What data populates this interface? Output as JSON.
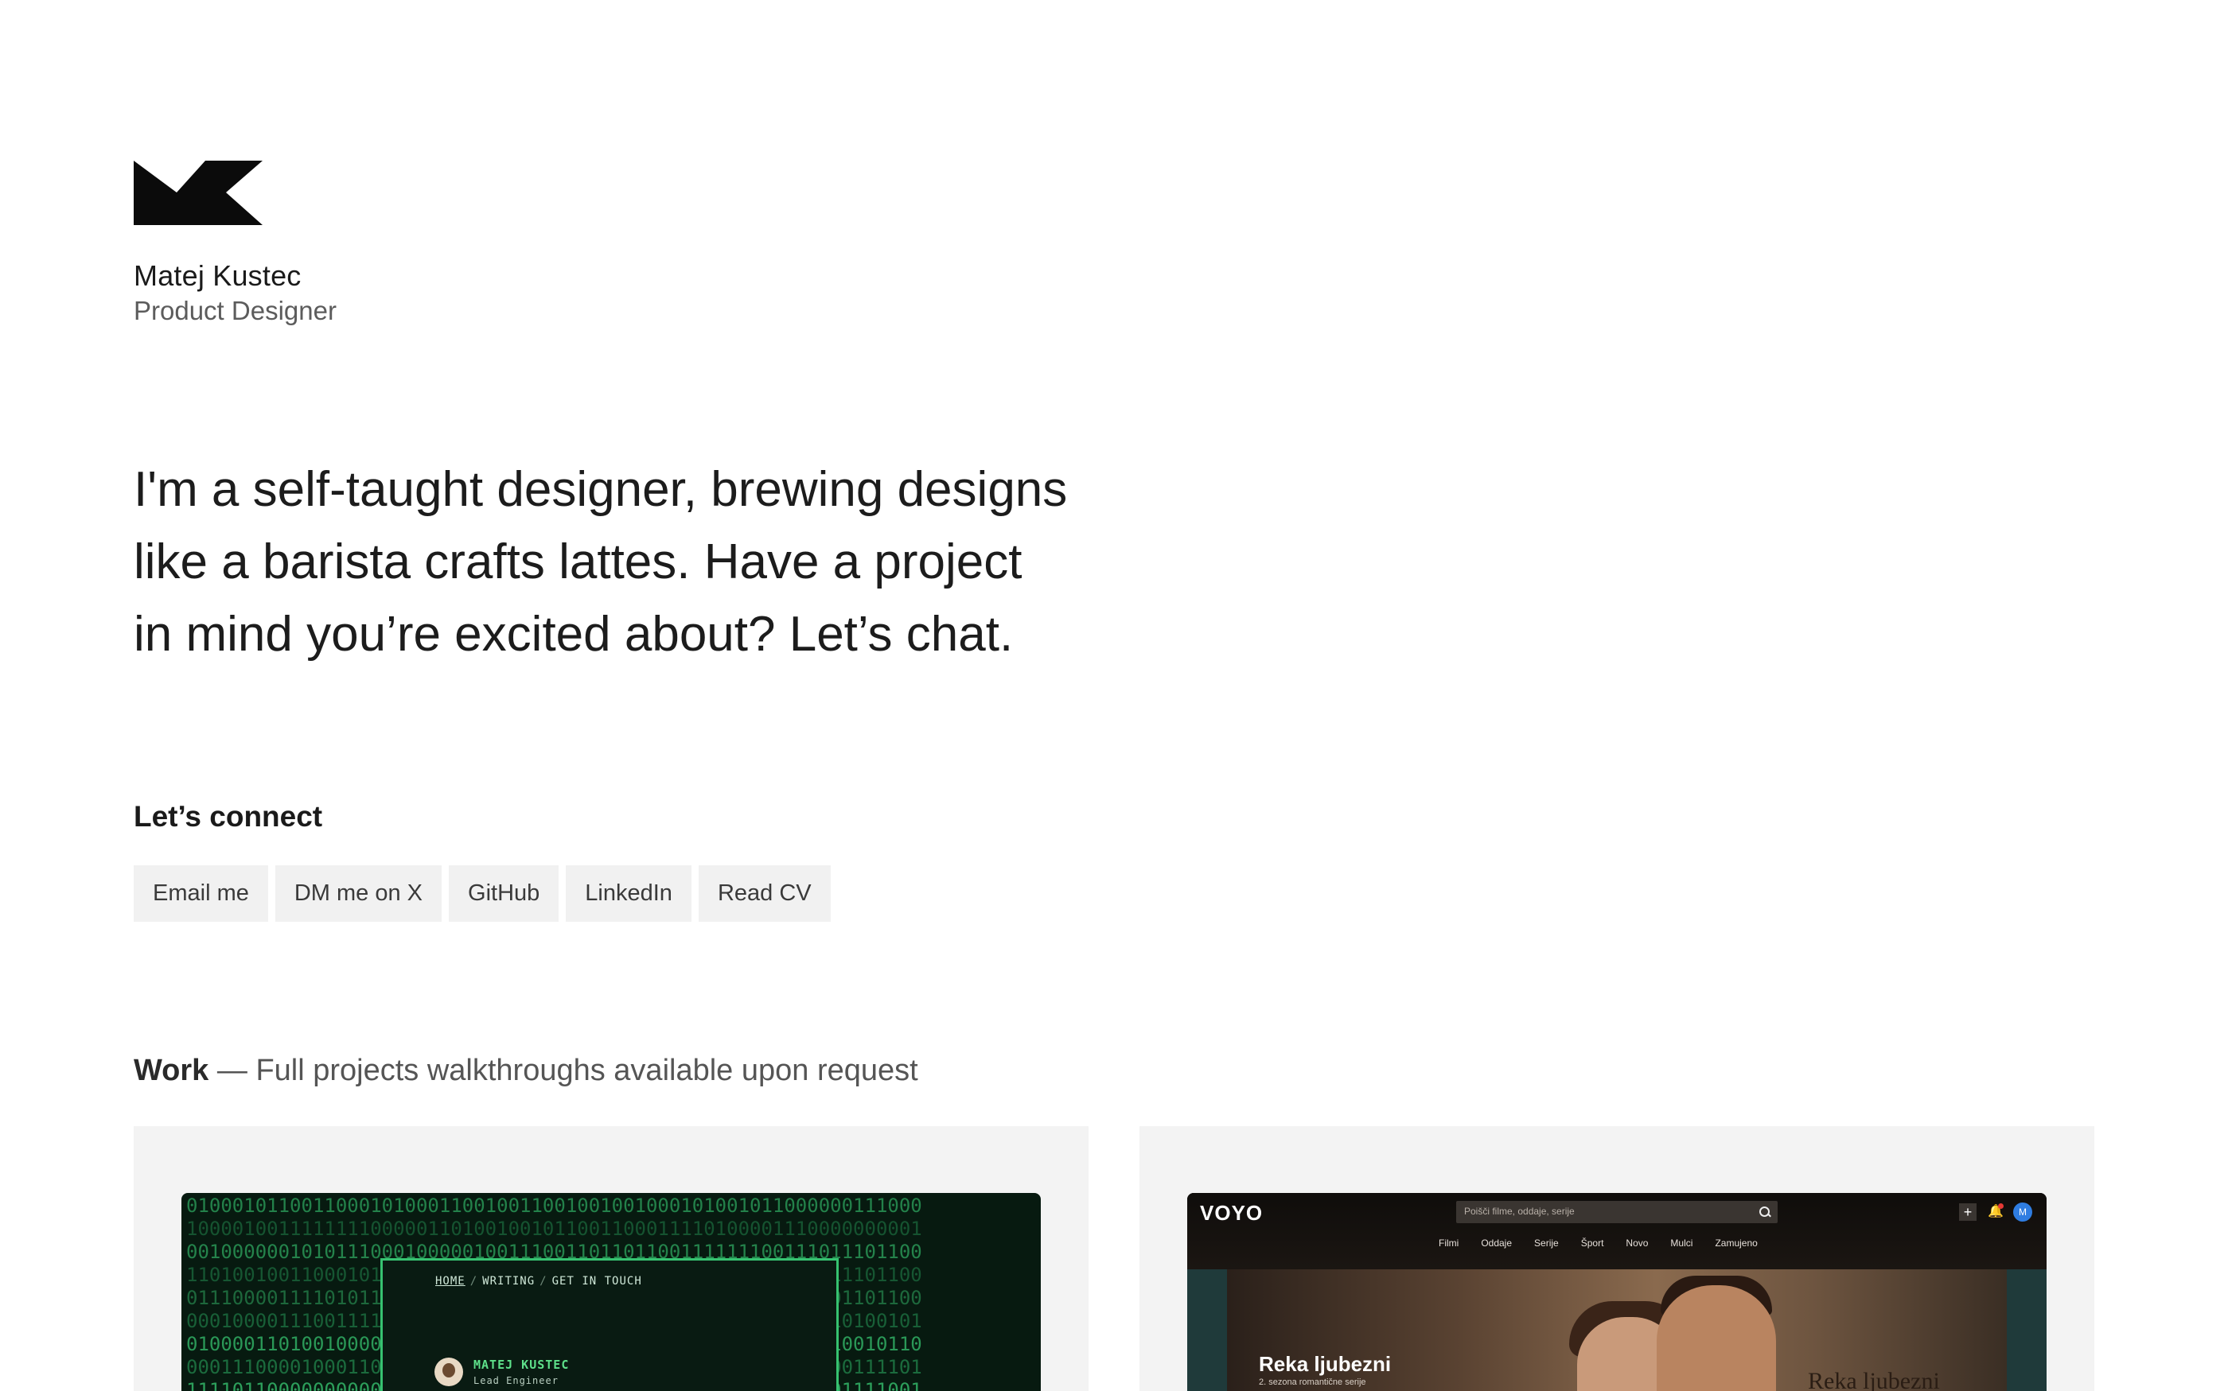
{
  "profile": {
    "name": "Matej Kustec",
    "role": "Product Designer"
  },
  "intro": {
    "lines": [
      "I'm a self-taught designer, brewing designs",
      "like a barista crafts lattes. Have a project",
      "in mind you’re excited about? Let’s chat."
    ]
  },
  "connect": {
    "title": "Let’s connect",
    "links": [
      "Email me",
      "DM me on X",
      "GitHub",
      "LinkedIn",
      "Read CV"
    ]
  },
  "work": {
    "label": "Work",
    "subtitle": " — Full projects walkthroughs available upon request"
  },
  "projects": [
    {
      "crumbs": [
        "HOME",
        "WRITING",
        "GET IN TOUCH"
      ],
      "name": "MATEJ KUSTEC",
      "role": "Lead Engineer",
      "accent": "#36c270"
    },
    {
      "logo": "VOYO",
      "search_placeholder": "Poišči filme, oddaje, serije",
      "nav": [
        "Filmi",
        "Oddaje",
        "Serije",
        "Šport",
        "Novo",
        "Mulci",
        "Zamujeno"
      ],
      "avatar_initial": "M",
      "hero_title": "Reka ljubezni",
      "hero_subtitle": "2. sezona romantične serije",
      "hero_script": "Reka ljubezni"
    }
  ]
}
